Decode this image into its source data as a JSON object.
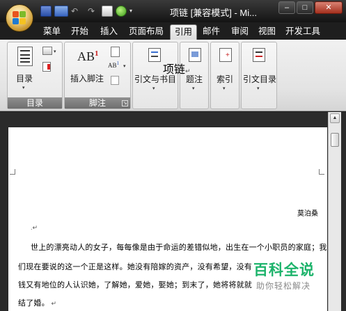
{
  "window": {
    "title": "项链 [兼容模式] - Mi...",
    "minimize": "–",
    "restore": "□",
    "close": "✕"
  },
  "quick_access": [
    "save-icon",
    "undo-icon",
    "redo-icon",
    "print-preview-icon",
    "spell-icon"
  ],
  "tabs": [
    "菜单",
    "开始",
    "插入",
    "页面布局",
    "引用",
    "邮件",
    "审阅",
    "视图",
    "开发工具"
  ],
  "active_tab": "引用",
  "ribbon": {
    "toc_group": {
      "label": "目录",
      "button": "目录"
    },
    "footnote_group": {
      "label": "脚注",
      "button": "插入脚注",
      "icon_text": "AB",
      "icon_sup": "1"
    },
    "citations": {
      "button": "引文与书目"
    },
    "captions": {
      "button": "题注"
    },
    "index": {
      "button": "索引"
    },
    "toa": {
      "button": "引文目录"
    }
  },
  "document": {
    "title": "项链",
    "author": "莫泊桑",
    "lines": [
      "世上的漂亮动人的女子，每每像是由于命运的差错似地，出生在一个小职员的家庭；我",
      "们现在要说的这一个正是这样。她没有陪嫁的资产，没有希望，没有",
      "钱又有地位的人认识她，了解她，爱她，娶她；到末了，她将将就就",
      "结了婚。"
    ]
  },
  "watermark": {
    "main": "百科全说",
    "sub": "助你轻松解决"
  },
  "colors": {
    "accent_green": "#1db36b",
    "ribbon_bg": "#e3e3e3",
    "titlebar": "#1e1e1e"
  }
}
